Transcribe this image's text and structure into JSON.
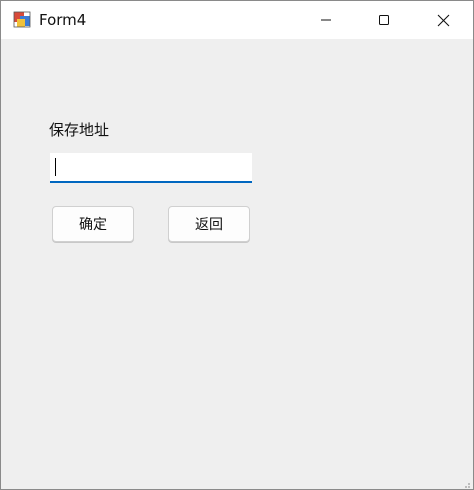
{
  "window": {
    "title": "Form4"
  },
  "form": {
    "path_label": "保存地址",
    "path_value": "",
    "ok_button": "确定",
    "back_button": "返回"
  },
  "icons": {
    "app": "app-icon",
    "minimize": "minimize-icon",
    "maximize": "maximize-icon",
    "close": "close-icon",
    "grip": "resize-grip-icon"
  },
  "colors": {
    "focus_underline": "#0067c0",
    "client_bg": "#efefef"
  }
}
